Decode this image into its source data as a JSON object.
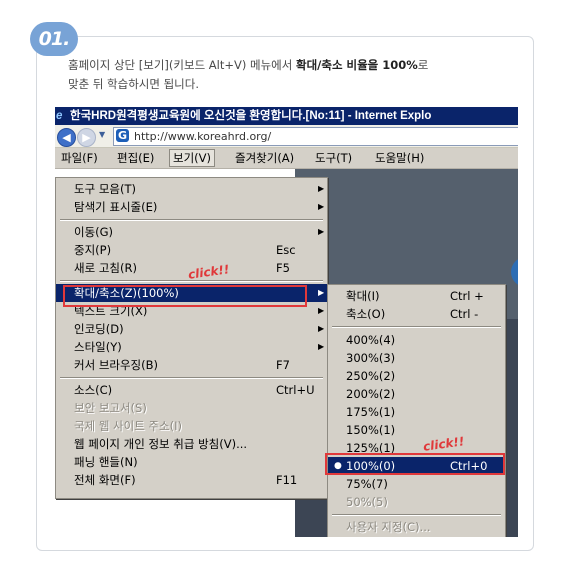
{
  "step": "01.",
  "instruction": {
    "line1_pre": "홈페이지 상단 [보기](키보드 Alt+V) 메뉴에서 ",
    "line1_bold": "확대/축소 비율을 100%",
    "line1_post": "로",
    "line2": "맞춘 뒤 학습하시면 됩니다."
  },
  "browser": {
    "title": "한국HRD원격평생교육원에 오신것을 환영합니다.[No:11] - Internet Explo",
    "url": "http://www.koreahrd.org/",
    "menubar": [
      "파일(F)",
      "편집(E)",
      "보기(V)",
      "즐겨찾기(A)",
      "도구(T)",
      "도움말(H)"
    ]
  },
  "view_menu": [
    {
      "label": "도구 모음(T)",
      "shortcut": "",
      "submenu": true
    },
    {
      "label": "탐색기 표시줄(E)",
      "shortcut": "",
      "submenu": true
    },
    {
      "label": "이동(G)",
      "shortcut": "",
      "submenu": true
    },
    {
      "label": "중지(P)",
      "shortcut": "Esc"
    },
    {
      "label": "새로 고침(R)",
      "shortcut": "F5"
    },
    {
      "label": "확대/축소(Z)(100%)",
      "shortcut": "",
      "submenu": true
    },
    {
      "label": "텍스트 크기(X)",
      "shortcut": "",
      "submenu": true
    },
    {
      "label": "인코딩(D)",
      "shortcut": "",
      "submenu": true
    },
    {
      "label": "스타일(Y)",
      "shortcut": "",
      "submenu": true
    },
    {
      "label": "커서 브라우징(B)",
      "shortcut": "F7"
    },
    {
      "label": "소스(C)",
      "shortcut": "Ctrl+U"
    },
    {
      "label": "보안 보고서(S)",
      "shortcut": ""
    },
    {
      "label": "국제 웹 사이트 주소(I)",
      "shortcut": ""
    },
    {
      "label": "웹 페이지 개인 정보 취급 방침(V)...",
      "shortcut": ""
    },
    {
      "label": "패닝 핸들(N)",
      "shortcut": ""
    },
    {
      "label": "전체 화면(F)",
      "shortcut": "F11"
    }
  ],
  "zoom_menu": [
    {
      "label": "확대(I)",
      "shortcut": "Ctrl +"
    },
    {
      "label": "축소(O)",
      "shortcut": "Ctrl -"
    },
    {
      "label": "400%(4)",
      "shortcut": ""
    },
    {
      "label": "300%(3)",
      "shortcut": ""
    },
    {
      "label": "250%(2)",
      "shortcut": ""
    },
    {
      "label": "200%(2)",
      "shortcut": ""
    },
    {
      "label": "175%(1)",
      "shortcut": ""
    },
    {
      "label": "150%(1)",
      "shortcut": ""
    },
    {
      "label": "125%(1)",
      "shortcut": ""
    },
    {
      "label": "100%(0)",
      "shortcut": "Ctrl+0",
      "selected": true
    },
    {
      "label": "75%(7)",
      "shortcut": ""
    },
    {
      "label": "50%(5)",
      "shortcut": ""
    },
    {
      "label": "사용자 지정(C)...",
      "shortcut": ""
    }
  ],
  "annotations": {
    "click1": "click!!",
    "click2": "click!!"
  },
  "colors": {
    "highlight": "#0a246a",
    "annotation": "#e0383a",
    "badge": "#78a3d6"
  }
}
